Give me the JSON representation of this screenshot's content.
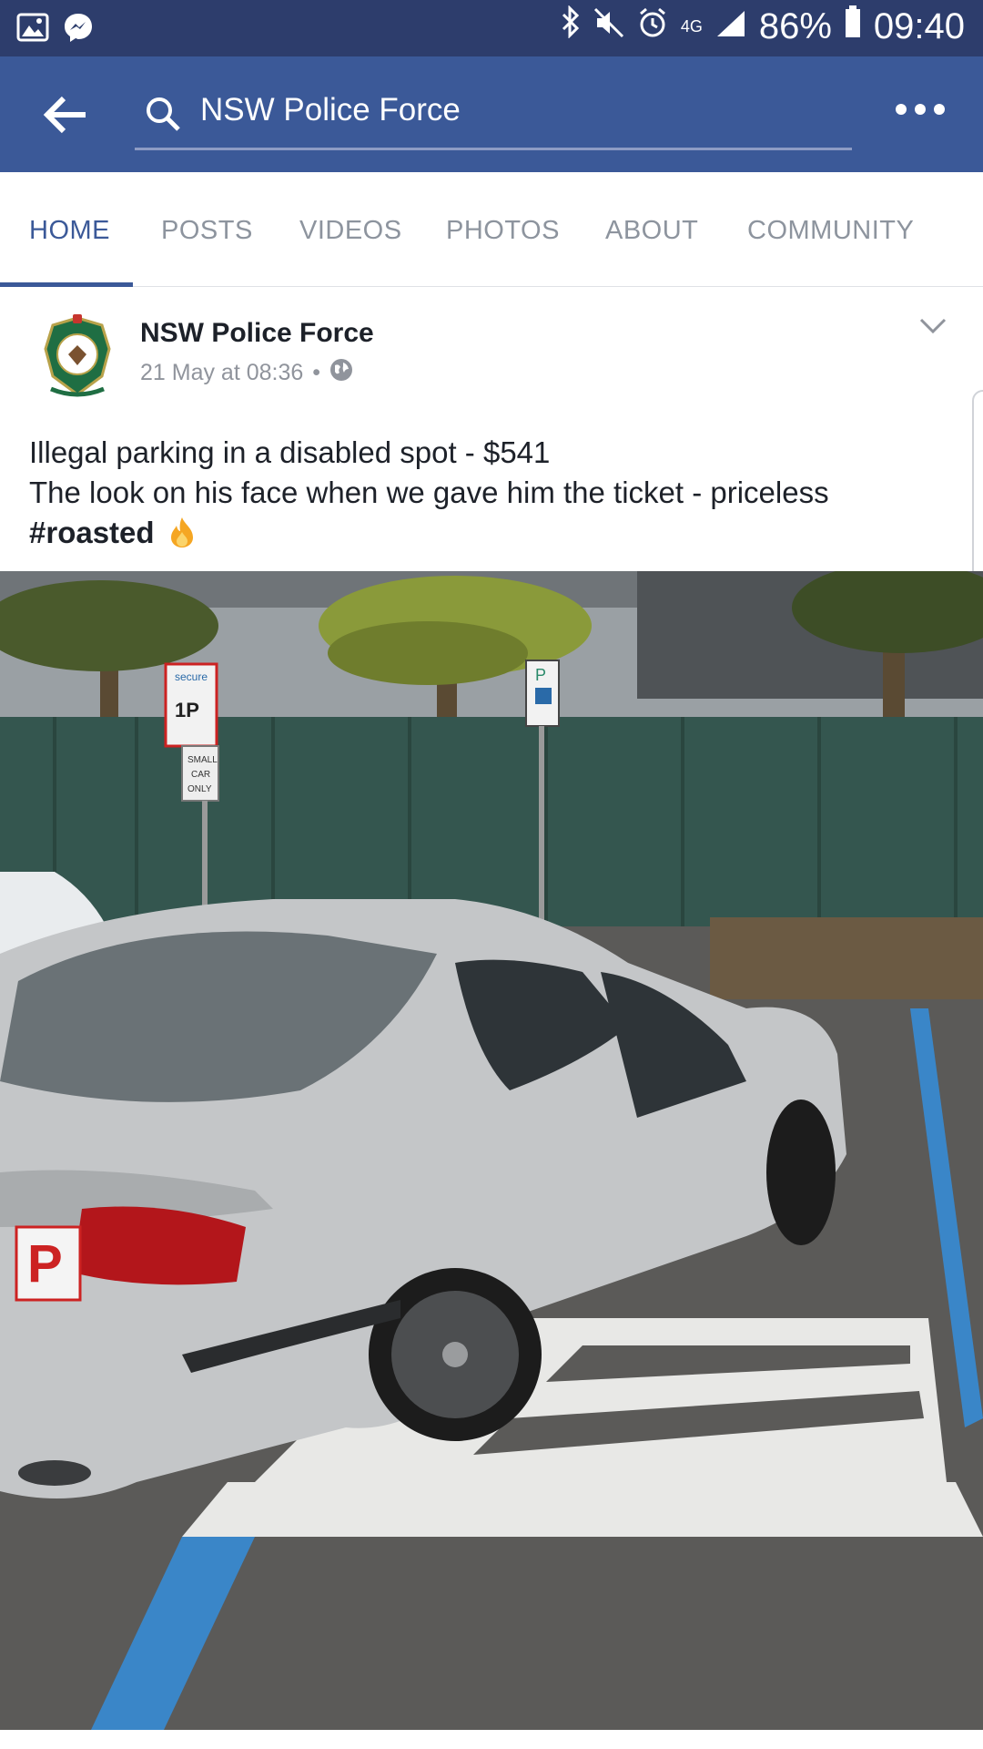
{
  "status_bar": {
    "network": "4G",
    "battery": "86%",
    "time": "09:40",
    "icons": [
      "gallery-icon",
      "messenger-icon",
      "bluetooth-icon",
      "mute-icon",
      "alarm-icon",
      "signal-icon",
      "battery-icon"
    ]
  },
  "topbar": {
    "search_text": "NSW Police Force",
    "icons": [
      "back-arrow-icon",
      "search-icon",
      "more-icon"
    ]
  },
  "tabs": [
    {
      "label": "HOME",
      "active": true
    },
    {
      "label": "POSTS",
      "active": false
    },
    {
      "label": "VIDEOS",
      "active": false
    },
    {
      "label": "PHOTOS",
      "active": false
    },
    {
      "label": "ABOUT",
      "active": false
    },
    {
      "label": "COMMUNITY",
      "active": false
    }
  ],
  "post": {
    "author": "NSW Police Force",
    "timestamp": "21 May at 08:36",
    "separator": "•",
    "privacy_icon": "globe-icon",
    "text_line1": "Illegal parking in a disabled spot - $541",
    "text_line2": "The look on his face when we gave him the ticket - priceless",
    "hashtag": "#roasted",
    "emoji": "fire-icon",
    "photo": {
      "signs": [
        "secure",
        "1P",
        "SMALL",
        "CAR",
        "ONLY",
        "P"
      ],
      "plate_sticker": "P"
    }
  },
  "colors": {
    "statusbar": "#2d3d6c",
    "brand": "#3b5998",
    "tab_inactive": "#8d949e",
    "text": "#1d2129",
    "meta": "#90949c"
  }
}
